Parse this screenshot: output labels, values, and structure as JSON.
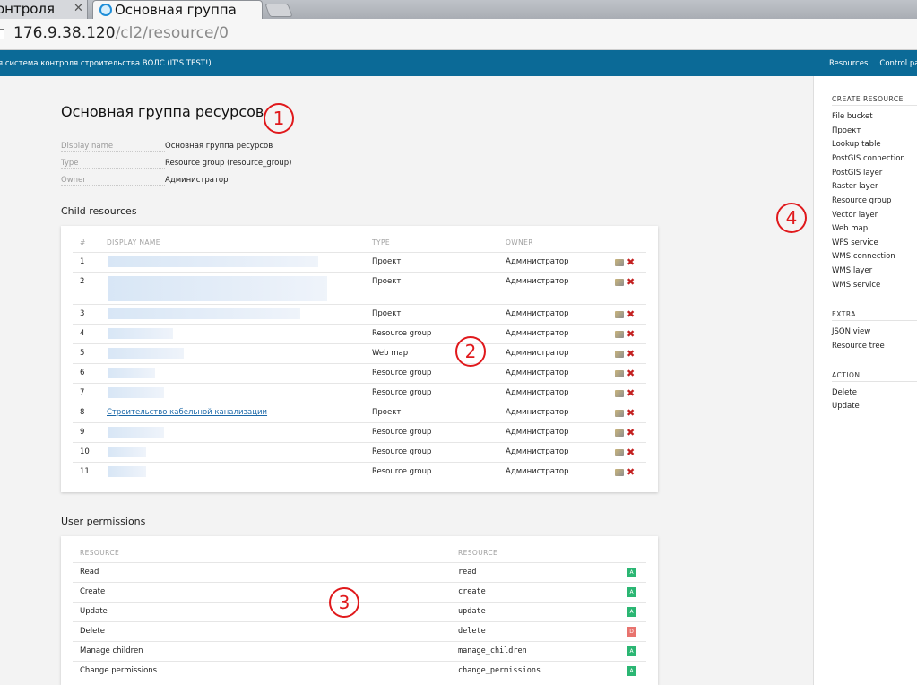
{
  "browser": {
    "tabs": [
      {
        "title": "онтроля"
      },
      {
        "title": "Основная группа"
      }
    ],
    "address": {
      "host": "176.9.38.120",
      "path": "/cl2/resource/0"
    }
  },
  "header": {
    "app_name": "я система контроля строительства ВОЛС (IT'S TEST!)",
    "nav": [
      "Resources",
      "Control pa"
    ]
  },
  "page": {
    "title": "Основная группа ресурсов",
    "meta": [
      {
        "key": "Display name",
        "value": "Основная группа ресурсов"
      },
      {
        "key": "Type",
        "value": "Resource group (resource_group)"
      },
      {
        "key": "Owner",
        "value": "Администратор"
      }
    ]
  },
  "child_resources": {
    "section_title": "Child resources",
    "columns": [
      "#",
      "DISPLAY NAME",
      "TYPE",
      "OWNER"
    ],
    "rows": [
      {
        "num": "1",
        "name": "",
        "type": "Проект",
        "owner": "Администратор"
      },
      {
        "num": "2",
        "name": "",
        "type": "Проект",
        "owner": "Администратор"
      },
      {
        "num": "3",
        "name": "",
        "type": "Проект",
        "owner": "Администратор"
      },
      {
        "num": "4",
        "name": "",
        "type": "Resource group",
        "owner": "Администратор"
      },
      {
        "num": "5",
        "name": "",
        "type": "Web map",
        "owner": "Администратор"
      },
      {
        "num": "6",
        "name": "",
        "type": "Resource group",
        "owner": "Администратор"
      },
      {
        "num": "7",
        "name": "",
        "type": "Resource group",
        "owner": "Администратор"
      },
      {
        "num": "8",
        "name": "Строительство кабельной канализации",
        "type": "Проект",
        "owner": "Администратор"
      },
      {
        "num": "9",
        "name": "",
        "type": "Resource group",
        "owner": "Администратор"
      },
      {
        "num": "10",
        "name": "",
        "type": "Resource group",
        "owner": "Администратор"
      },
      {
        "num": "11",
        "name": "",
        "type": "Resource group",
        "owner": "Администратор"
      }
    ]
  },
  "user_permissions": {
    "section_title": "User permissions",
    "columns": [
      "RESOURCE",
      "RESOURCE"
    ],
    "rows": [
      {
        "name": "Read",
        "id": "read",
        "state": "A"
      },
      {
        "name": "Create",
        "id": "create",
        "state": "A"
      },
      {
        "name": "Update",
        "id": "update",
        "state": "A"
      },
      {
        "name": "Delete",
        "id": "delete",
        "state": "D"
      },
      {
        "name": "Manage children",
        "id": "manage_children",
        "state": "A"
      },
      {
        "name": "Change permissions",
        "id": "change_permissions",
        "state": "A"
      }
    ]
  },
  "sidebar": {
    "create_title": "CREATE RESOURCE",
    "create_items": [
      "File bucket",
      "Проект",
      "Lookup table",
      "PostGIS connection",
      "PostGIS layer",
      "Raster layer",
      "Resource group",
      "Vector layer",
      "Web map",
      "WFS service",
      "WMS connection",
      "WMS layer",
      "WMS service"
    ],
    "extra_title": "EXTRA",
    "extra_items": [
      "JSON view",
      "Resource tree"
    ],
    "action_title": "ACTION",
    "action_items": [
      "Delete",
      "Update"
    ]
  },
  "annotations": [
    "1",
    "2",
    "3",
    "4"
  ],
  "colors": {
    "header_bg": "#0b6a97",
    "allow": "#2bb673",
    "deny": "#e8736e",
    "annotation": "#e0191c",
    "link": "#1b68a8"
  }
}
